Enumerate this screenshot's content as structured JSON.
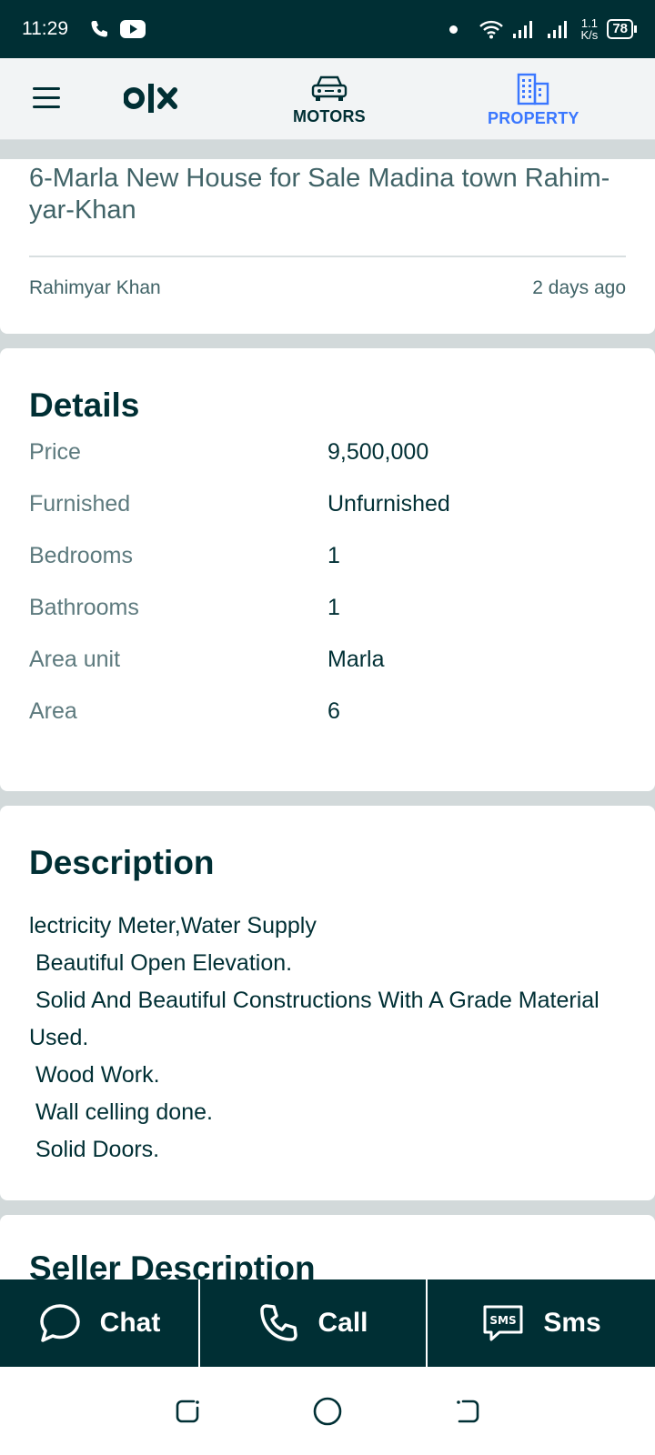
{
  "status_bar": {
    "time": "11:29",
    "net_speed_value": "1.1",
    "net_speed_unit": "K/s",
    "battery": "78"
  },
  "top_nav": {
    "motors_label": "MOTORS",
    "property_label": "PROPERTY",
    "active_color": "#3a77ff"
  },
  "ad": {
    "title": "6-Marla New House for Sale Madina town Rahim-yar-Khan",
    "location": "Rahimyar Khan",
    "posted": "2 days ago"
  },
  "details": {
    "title": "Details",
    "rows": [
      {
        "label": "Price",
        "value": "9,500,000"
      },
      {
        "label": "Furnished",
        "value": "Unfurnished"
      },
      {
        "label": "Bedrooms",
        "value": "1"
      },
      {
        "label": "Bathrooms",
        "value": "1"
      },
      {
        "label": "Area unit",
        "value": "Marla"
      },
      {
        "label": "Area",
        "value": "6"
      }
    ]
  },
  "description": {
    "title": "Description",
    "body": "lectricity Meter,Water Supply\n Beautiful Open Elevation.\n Solid And Beautiful Constructions With A Grade Material Used.\n Wood Work.\n Wall celling done.\n Solid Doors."
  },
  "seller": {
    "title": "Seller Description"
  },
  "actions": {
    "chat_label": "Chat",
    "call_label": "Call",
    "sms_label": "Sms"
  }
}
